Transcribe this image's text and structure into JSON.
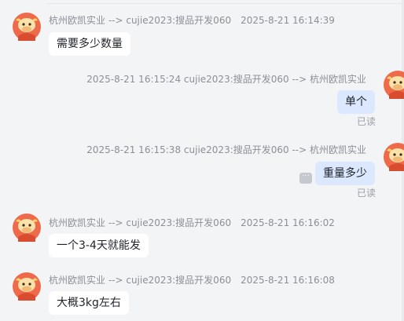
{
  "colors": {
    "background": "#f3f4f6",
    "bubble_in": "#ffffff",
    "bubble_out": "#dbe8ff",
    "meta_text": "#8c8f96",
    "avatar_red": "#ef6a4a",
    "avatar_yellow": "#f6d26b"
  },
  "messages": [
    {
      "direction": "incoming",
      "sender": "杭州欧凯实业 --> cujie2023:搜品开发060",
      "time": "2025-8-21 16:14:39",
      "text": "需要多少数量"
    },
    {
      "direction": "outgoing",
      "time": "2025-8-21 16:15:24",
      "sender": "cujie2023:搜品开发060 --> 杭州欧凯实业",
      "text": "单个",
      "status": "已读"
    },
    {
      "direction": "outgoing",
      "time": "2025-8-21 16:15:38",
      "sender": "cujie2023:搜品开发060 --> 杭州欧凯实业",
      "text": "重量多少",
      "status": "已读",
      "more_icon": "ellipsis-icon"
    },
    {
      "direction": "incoming",
      "sender": "杭州欧凯实业 --> cujie2023:搜品开发060",
      "time": "2025-8-21 16:16:02",
      "text": "一个3-4天就能发"
    },
    {
      "direction": "incoming",
      "sender": "杭州欧凯实业 --> cujie2023:搜品开发060",
      "time": "2025-8-21 16:16:08",
      "text": "大概3kg左右"
    }
  ]
}
